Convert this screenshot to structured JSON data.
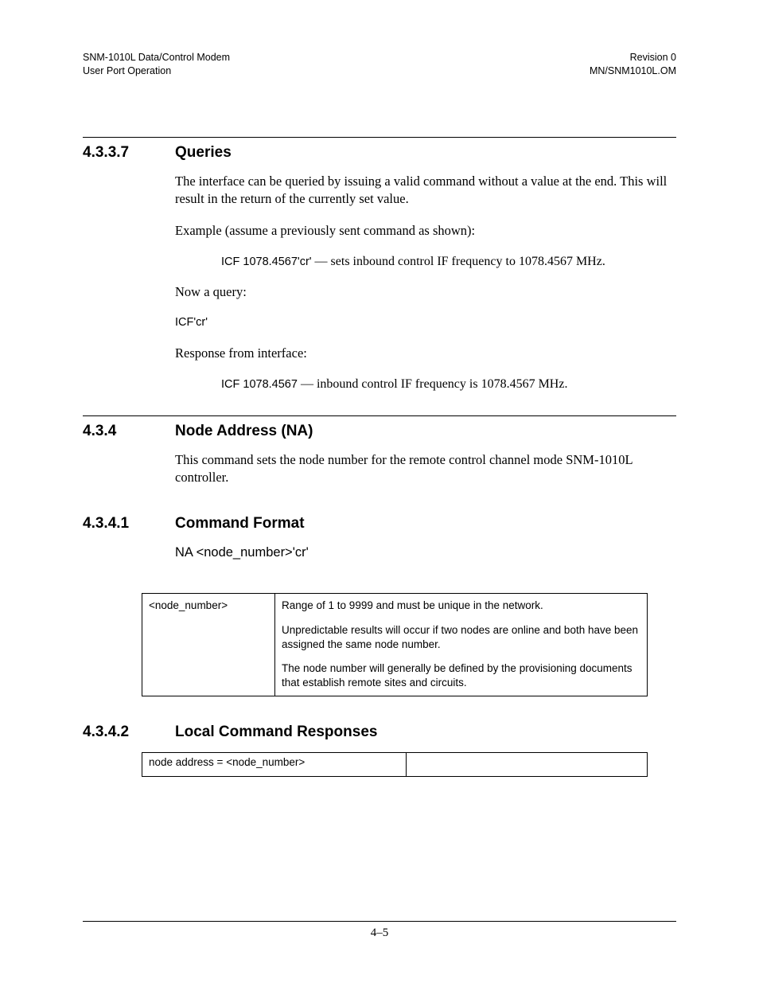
{
  "header": {
    "left_line1": "SNM-1010L Data/Control Modem",
    "left_line2": "User Port Operation",
    "right_line1": "Revision 0",
    "right_line2": "MN/SNM1010L.OM"
  },
  "s4337": {
    "num": "4.3.3.7",
    "title": "Queries",
    "p1": "The interface can be queried by issuing a valid command without a value at the end. This will result in the return of the currently set value.",
    "p2": "Example  (assume a previously sent command as shown):",
    "ex1_cmd": "ICF 1078.4567'cr'",
    "ex1_rest": " — sets inbound control IF frequency to 1078.4567 MHz.",
    "p3": "Now a query:",
    "query": "ICF'cr'",
    "p4": "Response from interface:",
    "resp_cmd": "ICF 1078.4567",
    "resp_rest": " — inbound control IF frequency is 1078.4567 MHz."
  },
  "s434": {
    "num": "4.3.4",
    "title": "Node Address (NA)",
    "p1": "This command sets the node number for the remote control channel mode SNM-1010L controller."
  },
  "s4341": {
    "num": "4.3.4.1",
    "title": "Command Format",
    "cmd": "NA <node_number>'cr'",
    "param_name": "<node_number>",
    "param_p1": "Range of 1 to 9999 and must be unique in the network.",
    "param_p2": "Unpredictable results will occur if two nodes are online and both have been assigned the same node number.",
    "param_p3": "The node number will generally be defined by the provisioning documents that establish remote sites and circuits."
  },
  "s4342": {
    "num": "4.3.4.2",
    "title": "Local Command Responses",
    "row1": "node address = <node_number>"
  },
  "footer": {
    "page": "4–5"
  }
}
